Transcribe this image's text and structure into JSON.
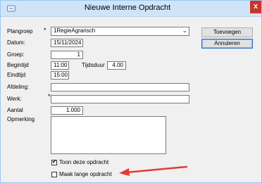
{
  "window": {
    "title": "Nieuwe Interne Opdracht",
    "close_label": "x",
    "accent_color": "#e53935",
    "icons": {
      "app": "window-app-icon",
      "close": "close-icon"
    }
  },
  "form": {
    "plangroep": {
      "label": "Plangroep",
      "required_mark": "*",
      "value": "1RegieAgrarisch"
    },
    "datum": {
      "label": "Datum:",
      "value": "15/11/2024"
    },
    "groep": {
      "label": "Groep:",
      "value": "1"
    },
    "begintijd": {
      "label": "Begintijd",
      "value": "11:00"
    },
    "tijdsduur": {
      "label": "Tijdsduur",
      "value": "4.00"
    },
    "eindtijd": {
      "label": "Eindtijd",
      "value": "15:00"
    },
    "afdeling": {
      "label": "Afdeling:",
      "value": ""
    },
    "werk": {
      "label": "Werk:",
      "required_mark": "*",
      "value": ""
    },
    "aantal": {
      "label": "Aantal",
      "value": "1.000"
    },
    "opmerking": {
      "label": "Opmerking",
      "value": ""
    },
    "toon_deze_opdracht": {
      "label": "Toon deze opdracht",
      "checked": true,
      "mark": "✔"
    },
    "maak_lange_opdracht": {
      "label": "Maak lange opdracht",
      "checked": false
    }
  },
  "buttons": {
    "toevoegen": "Toevoegen",
    "annuleren": "Annuleren"
  }
}
